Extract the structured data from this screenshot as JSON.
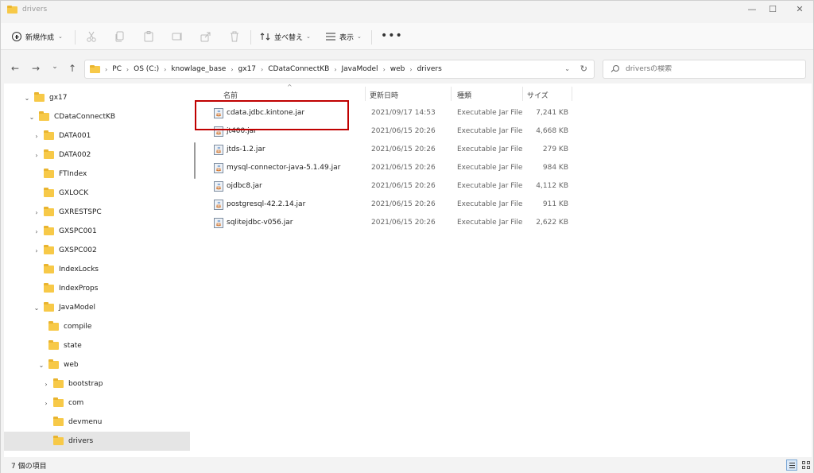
{
  "window": {
    "title": "drivers",
    "controls": {
      "minimize": "—",
      "maximize": "☐",
      "close": "✕"
    }
  },
  "toolbar": {
    "new_label": "新規作成",
    "sort_label": "並べ替え",
    "view_label": "表示",
    "more_label": "•••",
    "icons": [
      "cut-icon",
      "copy-icon",
      "paste-icon",
      "rename-icon",
      "share-icon",
      "delete-icon"
    ]
  },
  "nav": {
    "back": "←",
    "forward": "→",
    "recent": "⌄",
    "up": "↑",
    "breadcrumbs": [
      "PC",
      "OS (C:)",
      "knowlage_base",
      "gx17",
      "CDataConnectKB",
      "JavaModel",
      "web",
      "drivers"
    ],
    "refresh": "↻"
  },
  "search": {
    "placeholder": "driversの検索"
  },
  "sidebar": {
    "items": [
      {
        "label": "gx17",
        "expanded": true
      },
      {
        "label": "CDataConnectKB",
        "expanded": true
      },
      {
        "label": "DATA001",
        "expanded": false
      },
      {
        "label": "DATA002",
        "expanded": false
      },
      {
        "label": "FTIndex"
      },
      {
        "label": "GXLOCK"
      },
      {
        "label": "GXRESTSPC",
        "expanded": false
      },
      {
        "label": "GXSPC001",
        "expanded": false
      },
      {
        "label": "GXSPC002",
        "expanded": false
      },
      {
        "label": "IndexLocks"
      },
      {
        "label": "IndexProps"
      },
      {
        "label": "JavaModel",
        "expanded": true
      },
      {
        "label": "compile"
      },
      {
        "label": "state"
      },
      {
        "label": "web",
        "expanded": true
      },
      {
        "label": "bootstrap",
        "expanded": false
      },
      {
        "label": "com",
        "expanded": false
      },
      {
        "label": "devmenu"
      },
      {
        "label": "drivers",
        "selected": true
      }
    ]
  },
  "columns": {
    "name": "名前",
    "date": "更新日時",
    "type": "種類",
    "size": "サイズ"
  },
  "files": [
    {
      "name": "cdata.jdbc.kintone.jar",
      "date": "2021/09/17 14:53",
      "type": "Executable Jar File",
      "size": "7,241 KB"
    },
    {
      "name": "jt400.jar",
      "date": "2021/06/15 20:26",
      "type": "Executable Jar File",
      "size": "4,668 KB"
    },
    {
      "name": "jtds-1.2.jar",
      "date": "2021/06/15 20:26",
      "type": "Executable Jar File",
      "size": "279 KB"
    },
    {
      "name": "mysql-connector-java-5.1.49.jar",
      "date": "2021/06/15 20:26",
      "type": "Executable Jar File",
      "size": "984 KB"
    },
    {
      "name": "ojdbc8.jar",
      "date": "2021/06/15 20:26",
      "type": "Executable Jar File",
      "size": "4,112 KB"
    },
    {
      "name": "postgresql-42.2.14.jar",
      "date": "2021/06/15 20:26",
      "type": "Executable Jar File",
      "size": "911 KB"
    },
    {
      "name": "sqlitejdbc-v056.jar",
      "date": "2021/06/15 20:26",
      "type": "Executable Jar File",
      "size": "2,622 KB"
    }
  ],
  "status": {
    "item_count": "7 個の項目"
  },
  "colors": {
    "folder": "#f7c948",
    "highlight_box": "#c00000",
    "selected_row": "#e5e5e5"
  }
}
